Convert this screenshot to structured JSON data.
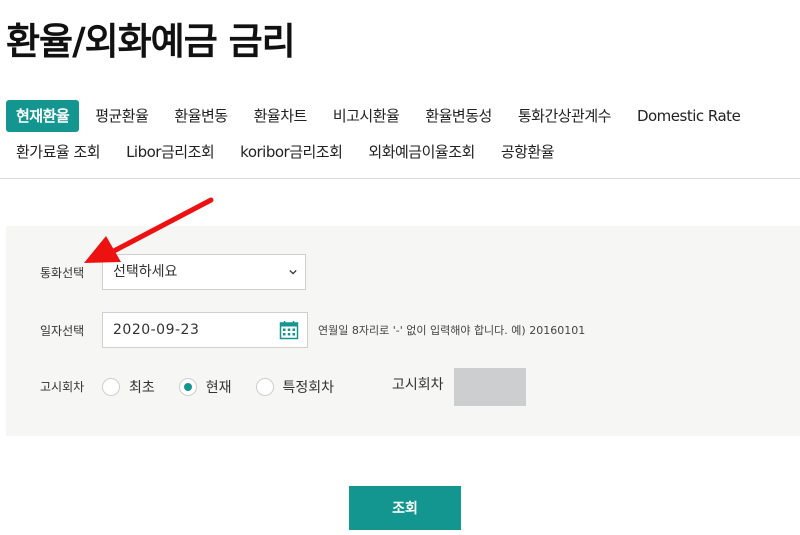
{
  "page": {
    "title": "환율/외화예금 금리"
  },
  "tabs": {
    "row1": [
      {
        "label": "현재환율",
        "active": true
      },
      {
        "label": "평균환율",
        "active": false
      },
      {
        "label": "환율변동",
        "active": false
      },
      {
        "label": "환율차트",
        "active": false
      },
      {
        "label": "비고시환율",
        "active": false
      },
      {
        "label": "환율변동성",
        "active": false
      },
      {
        "label": "통화간상관계수",
        "active": false
      },
      {
        "label": "Domestic Rate",
        "active": false
      }
    ],
    "row2": [
      {
        "label": "환가료율 조회"
      },
      {
        "label": "Libor금리조회"
      },
      {
        "label": "koribor금리조회"
      },
      {
        "label": "외화예금이율조회"
      },
      {
        "label": "공항환율"
      }
    ]
  },
  "form": {
    "currency_label": "통화선택",
    "currency_value": "선택하세요",
    "date_label": "일자선택",
    "date_value": "2020-09-23",
    "date_hint": "연월일 8자리로 '-' 없이 입력해야 합니다. 예) 20160101",
    "round_label": "고시회차",
    "radio_options": [
      {
        "label": "최초",
        "checked": false
      },
      {
        "label": "현재",
        "checked": true
      },
      {
        "label": "특정회차",
        "checked": false
      }
    ],
    "round_input_label": "고시회차",
    "round_input_value": "",
    "submit_label": "조회"
  },
  "colors": {
    "accent": "#139690",
    "annotation_arrow": "#ee1111"
  },
  "icons": {
    "date_picker": "calendar-icon",
    "select": "chevron-down-icon"
  }
}
